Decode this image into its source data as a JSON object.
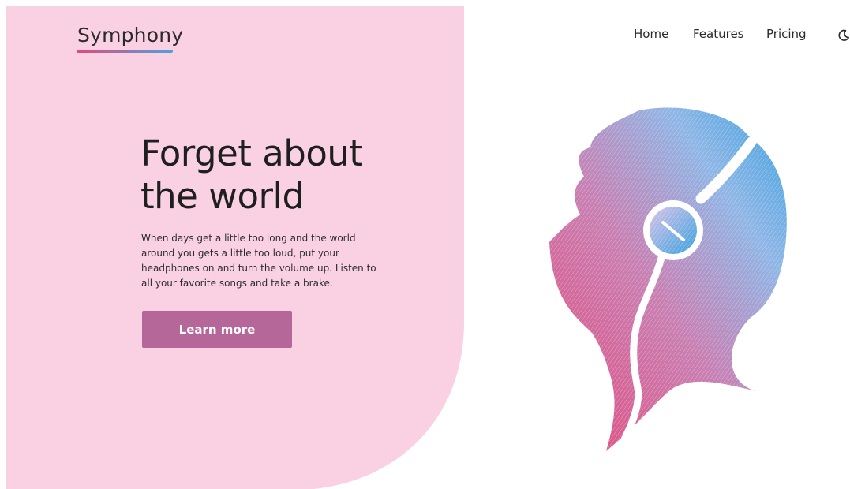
{
  "brand": {
    "name": "Symphony",
    "underline_colors": [
      "#e24a7c",
      "#4aa3e0"
    ]
  },
  "nav": {
    "items": [
      {
        "label": "Home"
      },
      {
        "label": "Features"
      },
      {
        "label": "Pricing"
      }
    ],
    "theme_toggle_icon": "moon-icon"
  },
  "hero": {
    "title": "Forget about the world",
    "description": "When days get a little too long and the world around you gets a little too loud, put your headphones on and turn the volume up. Listen to all your favorite songs and take a brake.",
    "cta_label": "Learn more",
    "illustration_icon": "head-with-headphones-icon"
  },
  "colors": {
    "hero_background": "#fad1e3",
    "cta_background": "#b5679a",
    "illustration_pink": "#e24a7c",
    "illustration_blue": "#3aa1df"
  }
}
